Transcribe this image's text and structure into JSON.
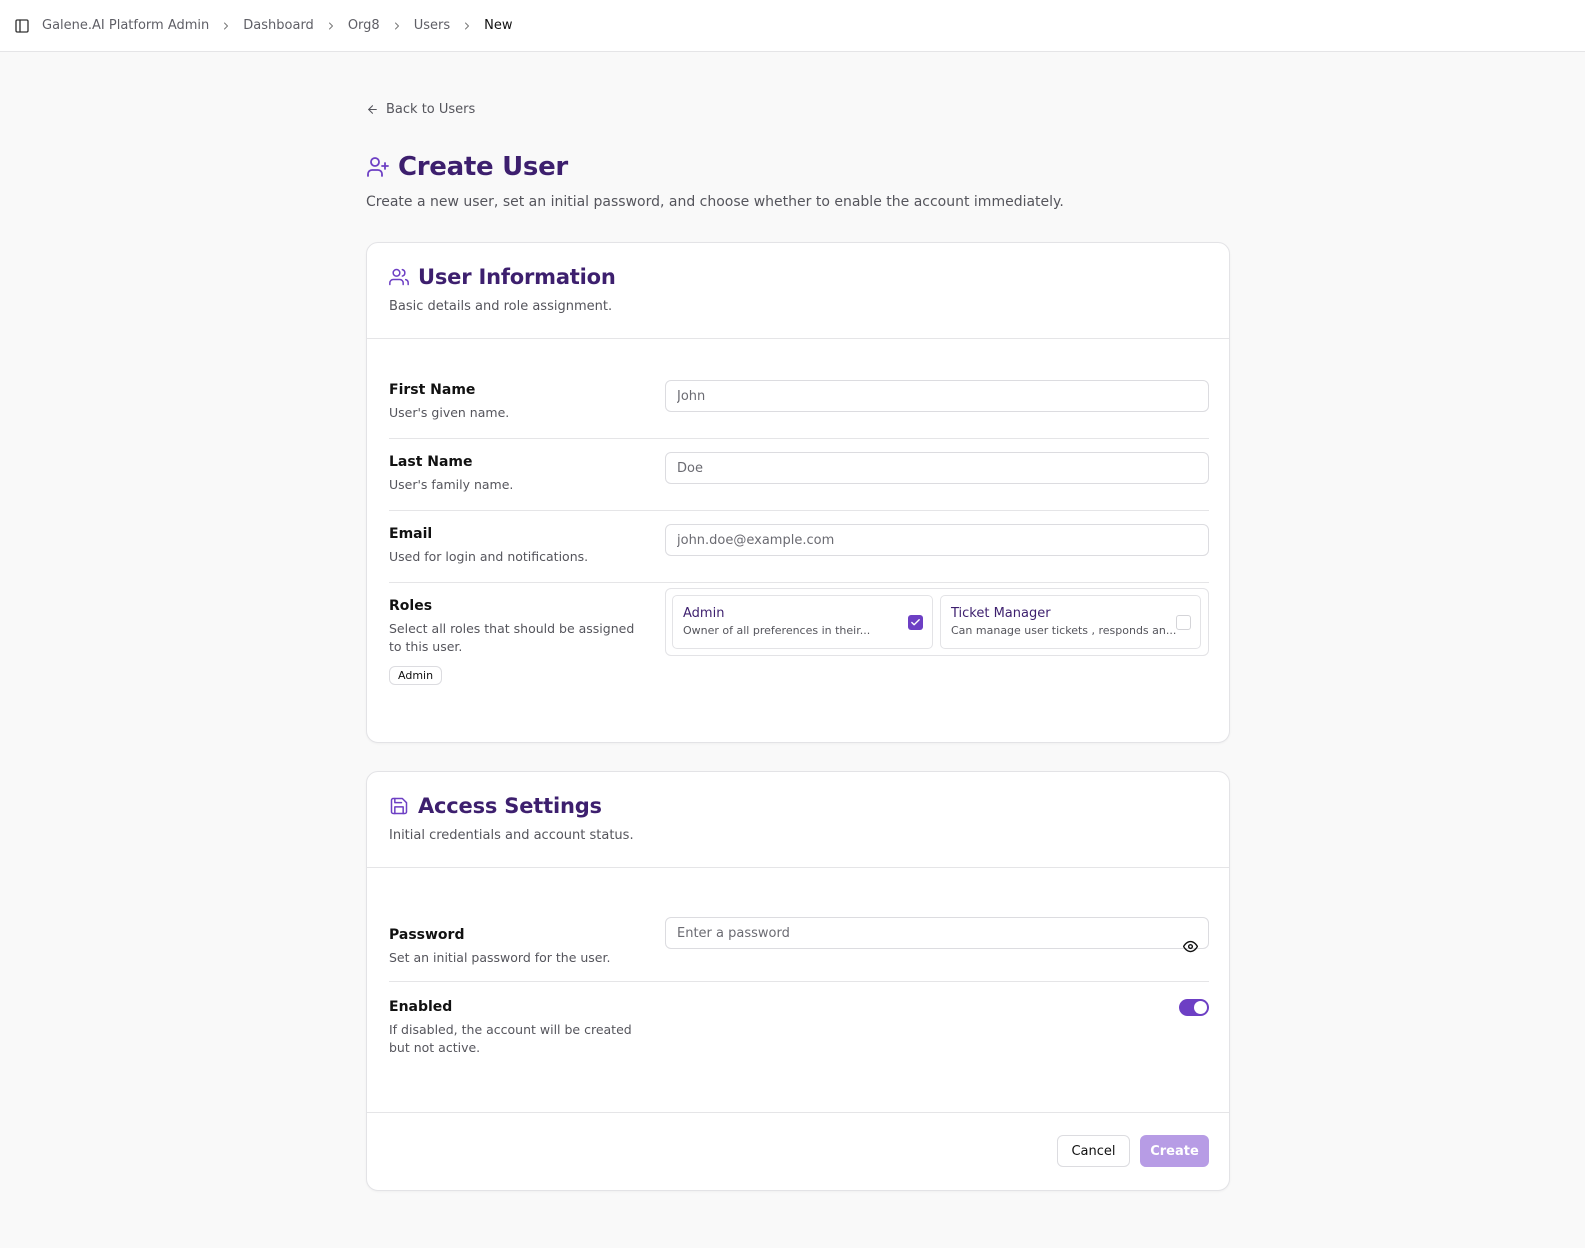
{
  "breadcrumb": {
    "items": [
      "Galene.AI Platform Admin",
      "Dashboard",
      "Org8",
      "Users"
    ],
    "current": "New"
  },
  "back_link": "Back to Users",
  "page": {
    "title": "Create User",
    "description": "Create a new user, set an initial password, and choose whether to enable the account immediately."
  },
  "user_info": {
    "title": "User Information",
    "subtitle": "Basic details and role assignment.",
    "first_name": {
      "label": "First Name",
      "hint": "User's given name.",
      "placeholder": "John"
    },
    "last_name": {
      "label": "Last Name",
      "hint": "User's family name.",
      "placeholder": "Doe"
    },
    "email": {
      "label": "Email",
      "hint": "Used for login and notifications.",
      "placeholder": "john.doe@example.com"
    },
    "roles": {
      "label": "Roles",
      "hint": "Select all roles that should be assigned to this user.",
      "selected_badge": "Admin",
      "options": [
        {
          "name": "Admin",
          "description": "Owner of all preferences in their...",
          "checked": true
        },
        {
          "name": "Ticket Manager",
          "description": "Can manage user tickets , responds an...",
          "checked": false
        }
      ]
    }
  },
  "access": {
    "title": "Access Settings",
    "subtitle": "Initial credentials and account status.",
    "password": {
      "label": "Password",
      "hint": "Set an initial password for the user.",
      "placeholder": "Enter a password"
    },
    "enabled": {
      "label": "Enabled",
      "hint": "If disabled, the account will be created but not active.",
      "value": true
    }
  },
  "actions": {
    "cancel": "Cancel",
    "create": "Create"
  },
  "colors": {
    "brand": "#3d1f6e",
    "accent": "#6d3fc4",
    "create_disabled": "#b79ce5"
  },
  "icons": {
    "sidebar_toggle": "panel-left-icon",
    "back": "arrow-left-icon",
    "page": "user-plus-icon",
    "user_info": "users-icon",
    "access": "save-icon",
    "password_toggle": "eye-icon"
  }
}
